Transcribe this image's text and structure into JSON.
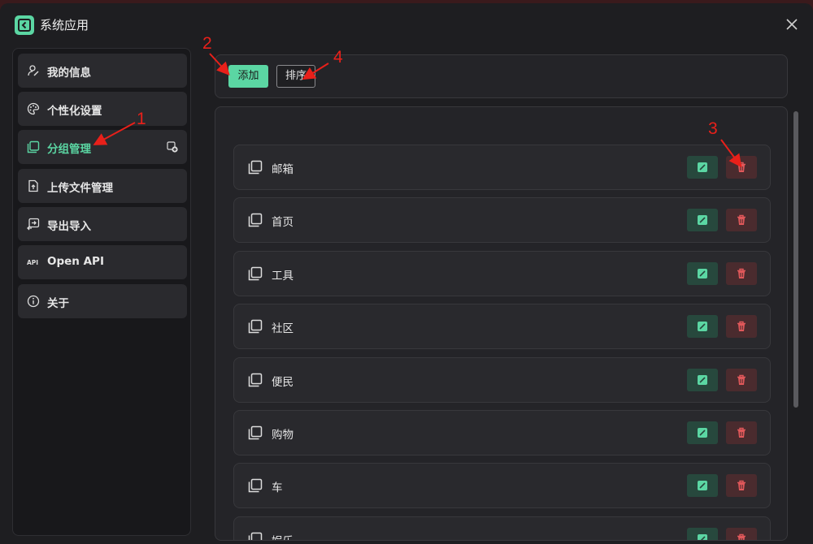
{
  "window": {
    "title": "系统应用"
  },
  "sidebar": {
    "items": [
      {
        "label": "我的信息",
        "icon": "user-edit-icon"
      },
      {
        "label": "个性化设置",
        "icon": "palette-icon"
      },
      {
        "label": "分组管理",
        "icon": "stack-icon",
        "active": true
      },
      {
        "label": "上传文件管理",
        "icon": "file-upload-icon"
      },
      {
        "label": "导出导入",
        "icon": "swap-icon"
      },
      {
        "label": "Open API",
        "icon": "api-icon"
      },
      {
        "label": "关于",
        "icon": "info-icon"
      }
    ]
  },
  "toolbar": {
    "add_label": "添加",
    "sort_label": "排序"
  },
  "groups": [
    {
      "name": "邮箱"
    },
    {
      "name": "首页"
    },
    {
      "name": "工具"
    },
    {
      "name": "社区"
    },
    {
      "name": "便民"
    },
    {
      "name": "购物"
    },
    {
      "name": "车"
    },
    {
      "name": "娱乐"
    }
  ],
  "annotations": [
    "1",
    "2",
    "3",
    "4"
  ],
  "colors": {
    "accent": "#5bd6a3",
    "danger": "#e0585a",
    "annotation": "#e8201a",
    "background": "#1e1e21"
  }
}
